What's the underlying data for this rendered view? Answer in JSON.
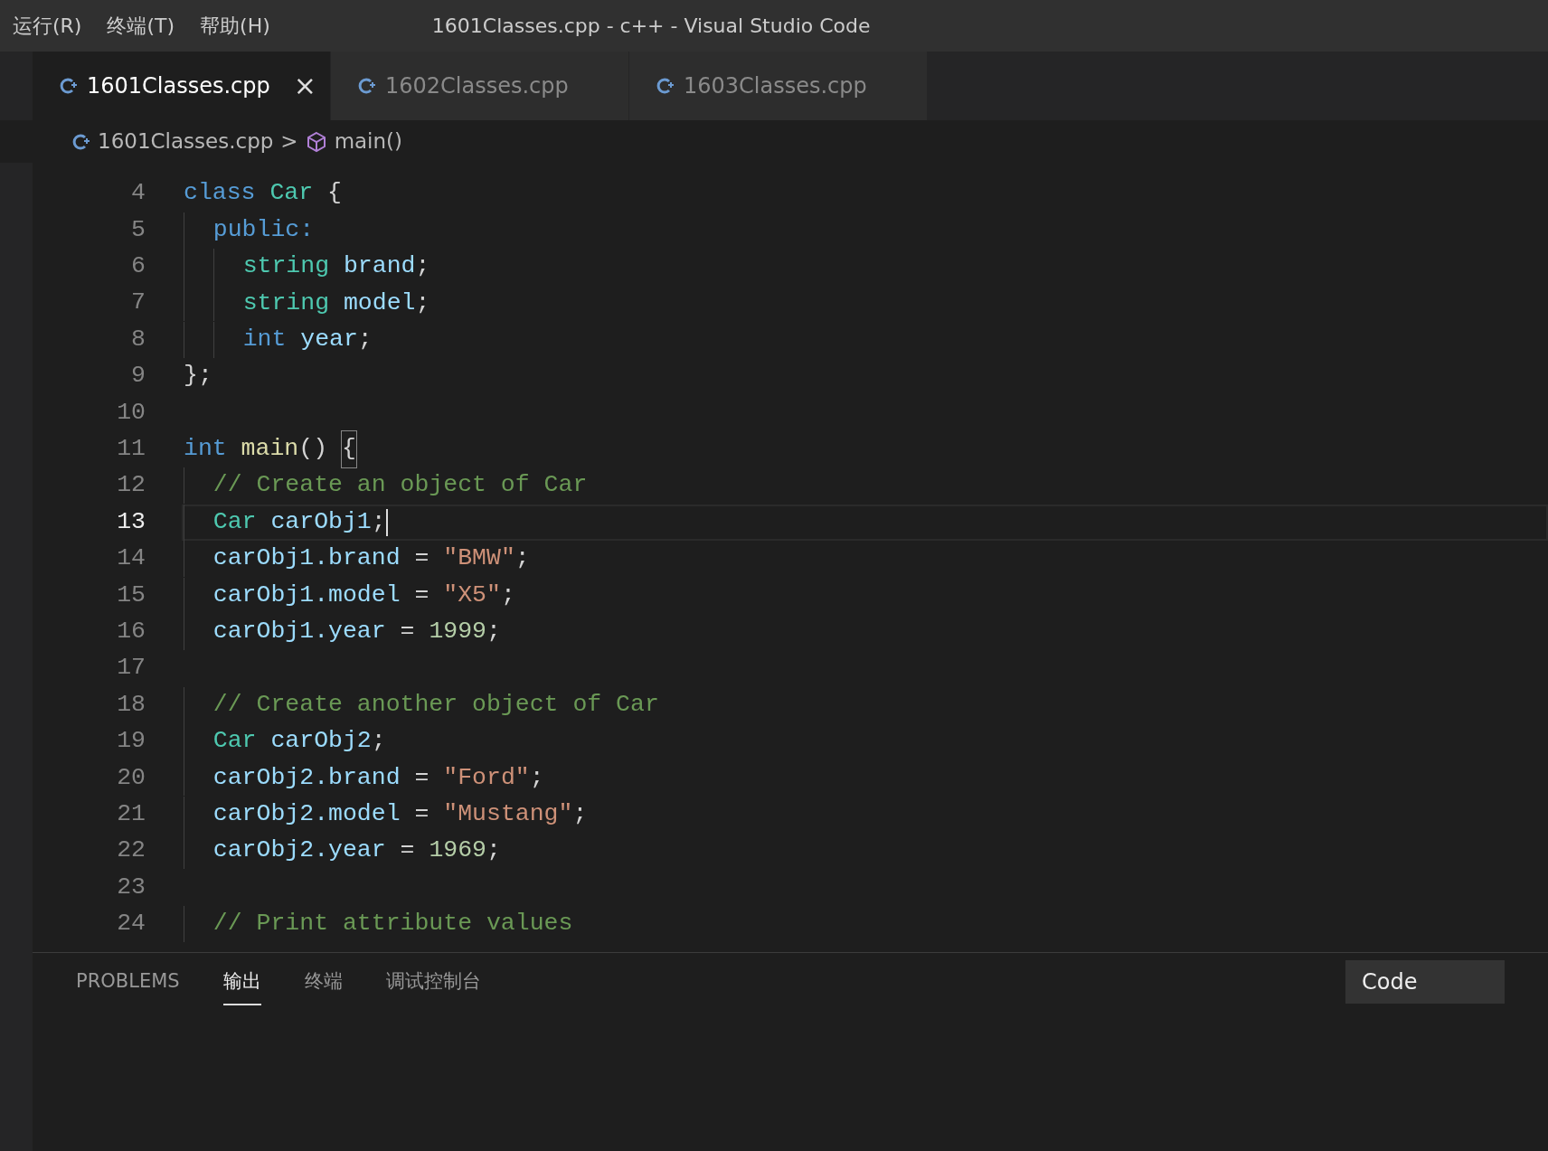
{
  "menu": [
    "运行(R)",
    "终端(T)",
    "帮助(H)"
  ],
  "window": {
    "title": "1601Classes.cpp - c++ - Visual Studio Code"
  },
  "tabs": [
    {
      "label": "1601Classes.cpp",
      "selected": true,
      "close": "×"
    },
    {
      "label": "1602Classes.cpp",
      "selected": false
    },
    {
      "label": "1603Classes.cpp",
      "selected": false
    }
  ],
  "breadcrumbs": {
    "file": "1601Classes.cpp",
    "separator": ">",
    "symbol": "main()"
  },
  "editor": {
    "lines": [
      {
        "number": "4",
        "active": false,
        "tokens": [
          {
            "kind": "kw",
            "text": "class"
          },
          {
            "kind": "type",
            "text": " Car"
          },
          {
            "kind": "p",
            "text": " {"
          }
        ]
      },
      {
        "number": "5",
        "active": false,
        "tokens": [
          {
            "kind": "kw",
            "text": "  public:"
          }
        ]
      },
      {
        "number": "6",
        "active": false,
        "tokens": [
          {
            "kind": "type",
            "text": "    string"
          },
          {
            "kind": "var",
            "text": " brand"
          },
          {
            "kind": "p",
            "text": ";"
          }
        ]
      },
      {
        "number": "7",
        "active": false,
        "tokens": [
          {
            "kind": "type",
            "text": "    string"
          },
          {
            "kind": "var",
            "text": " model"
          },
          {
            "kind": "p",
            "text": ";"
          }
        ]
      },
      {
        "number": "8",
        "active": false,
        "tokens": [
          {
            "kind": "kw",
            "text": "    int"
          },
          {
            "kind": "var",
            "text": " year"
          },
          {
            "kind": "p",
            "text": ";"
          }
        ]
      },
      {
        "number": "9",
        "active": false,
        "tokens": [
          {
            "kind": "p",
            "text": "};"
          }
        ]
      },
      {
        "number": "10",
        "active": false
      },
      {
        "number": "11",
        "active": false,
        "tokens": [
          {
            "kind": "kw",
            "text": "int"
          },
          {
            "kind": "fn",
            "text": " main"
          },
          {
            "kind": "p",
            "text": "() "
          },
          {
            "kind": "match",
            "text": "{"
          }
        ]
      },
      {
        "number": "12",
        "active": false,
        "tokens": [
          {
            "kind": "cmt",
            "text": "  // Create an object of Car"
          }
        ]
      },
      {
        "number": "13",
        "active": true,
        "tokens": [
          {
            "kind": "type",
            "text": "  Car"
          },
          {
            "kind": "var",
            "text": " carObj1"
          },
          {
            "kind": "p",
            "text": ";"
          }
        ]
      },
      {
        "number": "14",
        "active": false,
        "tokens": [
          {
            "kind": "var",
            "text": "  carObj1.brand"
          },
          {
            "kind": "p",
            "text": " = "
          },
          {
            "kind": "str",
            "text": "\"BMW\""
          },
          {
            "kind": "p",
            "text": ";"
          }
        ]
      },
      {
        "number": "15",
        "active": false,
        "tokens": [
          {
            "kind": "var",
            "text": "  carObj1.model"
          },
          {
            "kind": "p",
            "text": " = "
          },
          {
            "kind": "str",
            "text": "\"X5\""
          },
          {
            "kind": "p",
            "text": ";"
          }
        ]
      },
      {
        "number": "16",
        "active": false,
        "tokens": [
          {
            "kind": "var",
            "text": "  carObj1.year"
          },
          {
            "kind": "p",
            "text": " = "
          },
          {
            "kind": "num",
            "text": "1999"
          },
          {
            "kind": "p",
            "text": ";"
          }
        ]
      },
      {
        "number": "17",
        "active": false
      },
      {
        "number": "18",
        "active": false,
        "tokens": [
          {
            "kind": "cmt",
            "text": "  // Create another object of Car"
          }
        ]
      },
      {
        "number": "19",
        "active": false,
        "tokens": [
          {
            "kind": "type",
            "text": "  Car"
          },
          {
            "kind": "var",
            "text": " carObj2"
          },
          {
            "kind": "p",
            "text": ";"
          }
        ]
      },
      {
        "number": "20",
        "active": false,
        "tokens": [
          {
            "kind": "var",
            "text": "  carObj2.brand"
          },
          {
            "kind": "p",
            "text": " = "
          },
          {
            "kind": "str",
            "text": "\"Ford\""
          },
          {
            "kind": "p",
            "text": ";"
          }
        ]
      },
      {
        "number": "21",
        "active": false,
        "tokens": [
          {
            "kind": "var",
            "text": "  carObj2.model"
          },
          {
            "kind": "p",
            "text": " = "
          },
          {
            "kind": "str",
            "text": "\"Mustang\""
          },
          {
            "kind": "p",
            "text": ";"
          }
        ]
      },
      {
        "number": "22",
        "active": false,
        "tokens": [
          {
            "kind": "var",
            "text": "  carObj2.year"
          },
          {
            "kind": "p",
            "text": " = "
          },
          {
            "kind": "num",
            "text": "1969"
          },
          {
            "kind": "p",
            "text": ";"
          }
        ]
      },
      {
        "number": "23",
        "active": false
      },
      {
        "number": "24",
        "active": false,
        "tokens": [
          {
            "kind": "cmt",
            "text": "  // Print attribute values"
          }
        ]
      }
    ]
  },
  "panel": {
    "tabs": [
      {
        "label": "PROBLEMS",
        "selected": false
      },
      {
        "label": "输出",
        "selected": true
      },
      {
        "label": "终端",
        "selected": false
      },
      {
        "label": "调试控制台",
        "selected": false
      }
    ],
    "dropdown": "Code"
  }
}
